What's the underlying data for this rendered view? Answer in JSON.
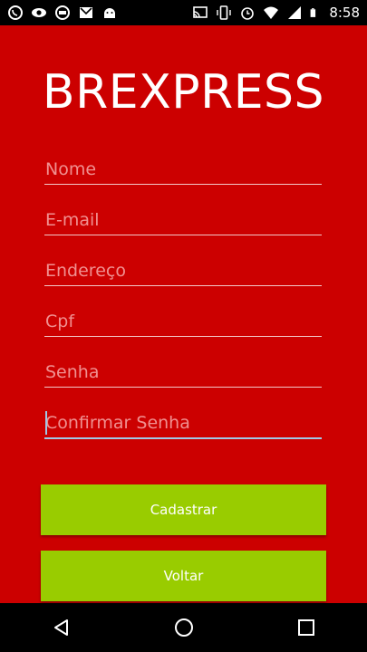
{
  "status_bar": {
    "time": "8:58",
    "left_icons": [
      "whatsapp-icon",
      "eye-icon",
      "chat-icon",
      "gmail-icon",
      "android-icon"
    ],
    "right_icons": [
      "cast-icon",
      "vibrate-icon",
      "alarm-icon",
      "wifi-icon",
      "signal-icon",
      "battery-icon"
    ]
  },
  "app": {
    "title": "BREXPRESS",
    "fields": {
      "nome": {
        "placeholder": "Nome",
        "value": ""
      },
      "email": {
        "placeholder": "E-mail",
        "value": ""
      },
      "endereco": {
        "placeholder": "Endereço",
        "value": ""
      },
      "cpf": {
        "placeholder": "Cpf",
        "value": ""
      },
      "senha": {
        "placeholder": "Senha",
        "value": ""
      },
      "confirmar_senha": {
        "placeholder": "Confirmar Senha",
        "value": ""
      }
    },
    "buttons": {
      "cadastrar": "Cadastrar",
      "voltar": "Voltar"
    }
  },
  "colors": {
    "background": "#cc0000",
    "button": "#99cc00",
    "placeholder": "#f09090",
    "focus": "#9fc8e8"
  },
  "nav_bar": {
    "icons": [
      "back-icon",
      "home-icon",
      "recents-icon"
    ]
  }
}
